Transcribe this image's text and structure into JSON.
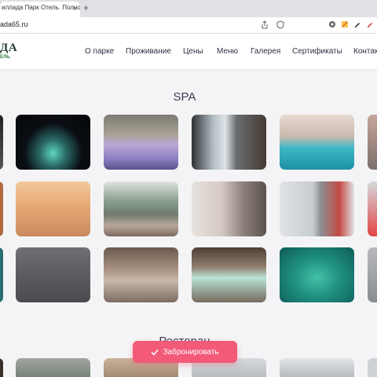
{
  "browser": {
    "tab_title": "иллада Парк Отель. Полноц",
    "tab_close_icon": "close-icon",
    "new_tab_icon": "plus-icon",
    "url": "ada65.ru",
    "tab_close_glyph": "×",
    "new_tab_glyph": "+"
  },
  "header": {
    "logo_text": "ДА",
    "logo_sub": "ЕЛЬ",
    "nav": [
      "О парке",
      "Проживание",
      "Цены",
      "Меню",
      "Галерея",
      "Сертификаты",
      "Контакты"
    ]
  },
  "sections": {
    "spa_title": "SPA",
    "restaurant_title": "Ресторан"
  },
  "gallery": {
    "spa_photos": [
      "spa-photo-edge-1",
      "outdoor-hot-tub-night",
      "jacuzzi-indoor",
      "spa-hall-windows",
      "indoor-pool",
      "sauna-women",
      "outdoor-hot-tub-group",
      "sauna-woman-relaxing",
      "locker-corridor",
      "spa-relax-room",
      "sauna-benches",
      "sauna-lit-benches",
      "heated-loungers"
    ]
  },
  "cta": {
    "book_label": "Забронировать",
    "check_icon": "check-icon"
  },
  "colors": {
    "accent": "#f25a78",
    "heading": "#3a3d52",
    "nav_text": "#2d2f45"
  }
}
